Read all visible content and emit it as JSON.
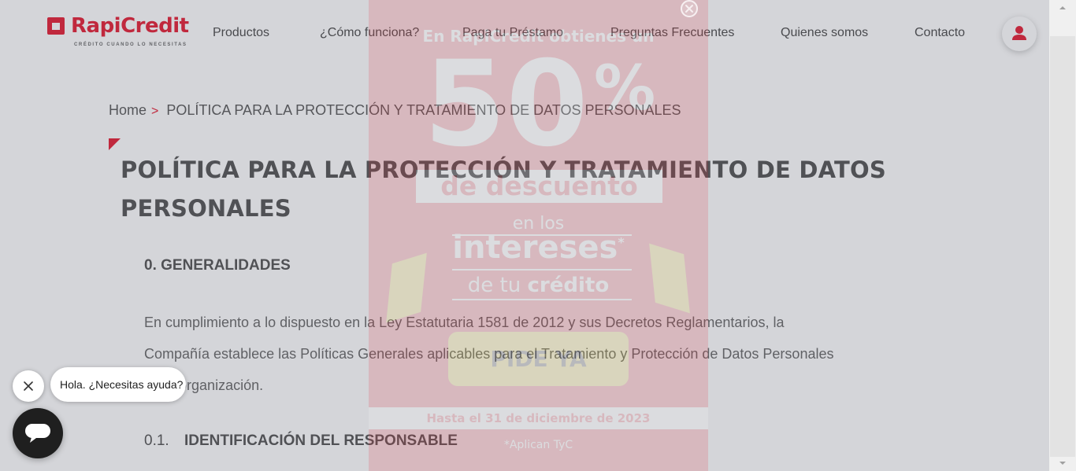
{
  "brand": {
    "name": "RapiCredit",
    "tagline": "CRÉDITO CUANDO LO NECESITAS",
    "accent_color": "#e2001a"
  },
  "nav": {
    "items": [
      {
        "label": "Productos"
      },
      {
        "label": "¿Cómo funciona?"
      },
      {
        "label": "Paga tu Préstamo"
      },
      {
        "label": "Preguntas Frecuentes"
      },
      {
        "label": "Quienes somos"
      },
      {
        "label": "Contacto"
      }
    ],
    "user_icon": "user-icon"
  },
  "breadcrumb": {
    "home": "Home",
    "separator": ">",
    "current": "POLÍTICA PARA LA PROTECCIÓN Y TRATAMIENTO DE DATOS PERSONALES"
  },
  "page": {
    "title": "POLÍTICA PARA LA PROTECCIÓN Y TRATAMIENTO DE DATOS PERSONALES",
    "section_title": "0. GENERALIDADES",
    "paragraph": "En cumplimiento a lo dispuesto en la Ley Estatutaria 1581 de 2012 y sus Decretos Reglamentarios, la Compañía establece las Políticas Generales aplicables para el Tratamiento y Protección de Datos Personales en la organización.",
    "subsection_number": "0.1.",
    "subsection_title": "IDENTIFICACIÓN DEL RESPONSABLE"
  },
  "promo": {
    "headline": "En RapiCredit obtienes un",
    "big_number": "50",
    "percent": "%",
    "discount": "de descuento",
    "line1": "en los",
    "line2": "intereses",
    "asterisk": "*",
    "line3_prefix": "de tu",
    "line3_bold": "crédito",
    "cta": "PIDE YA",
    "deadline": "Hasta el 31 de diciembre de 2023",
    "terms": "*Aplican TyC",
    "close_icon": "close-icon",
    "bg_color": "#e8323c",
    "cta_color": "#f6d93b"
  },
  "chat": {
    "greeting": "Hola. ¿Necesitas ayuda?",
    "close_icon": "close-icon",
    "chat_icon": "chat-icon"
  }
}
